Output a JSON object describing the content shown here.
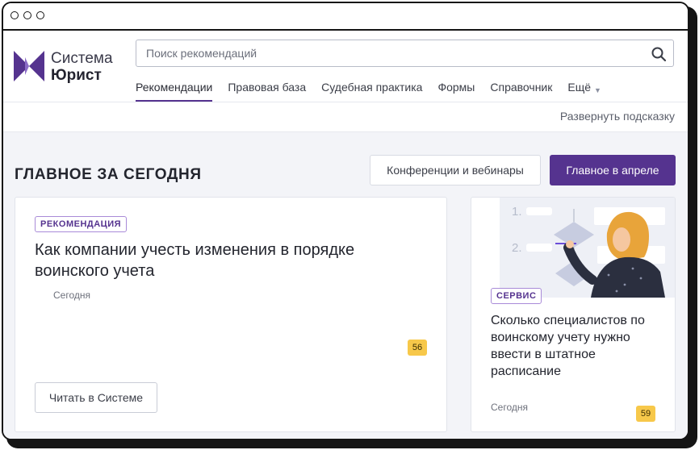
{
  "search": {
    "placeholder": "Поиск рекомендаций"
  },
  "logo": {
    "line1": "Система",
    "line2": "Юрист"
  },
  "nav": {
    "items": [
      "Рекомендации",
      "Правовая база",
      "Судебная практика",
      "Формы",
      "Справочник"
    ],
    "more_label": "Ещё",
    "active_index": 0
  },
  "hint": {
    "expand_label": "Развернуть подсказку"
  },
  "section": {
    "title": "ГЛАВНОЕ ЗА СЕГОДНЯ",
    "conferences_button": "Конференции и вебинары",
    "april_button": "Главное в апреле"
  },
  "cards": {
    "main": {
      "badge": "РЕКОМЕНДАЦИЯ",
      "title": "Как компании учесть изменения в порядке воинского учета",
      "date": "Сегодня",
      "count": "56",
      "read_button": "Читать в Системе"
    },
    "side": {
      "badge": "СЕРВИС",
      "title": "Сколько специалистов по воинскому учету нужно ввести в штатное расписание",
      "date": "Сегодня",
      "count": "59",
      "illustration_numbers": [
        "1.",
        "2."
      ]
    }
  },
  "colors": {
    "accent": "#55338f",
    "counter": "#f7c84a",
    "background": "#f3f4f8"
  },
  "icons": [
    "search-icon",
    "chevron-down-icon",
    "logo-icon"
  ]
}
